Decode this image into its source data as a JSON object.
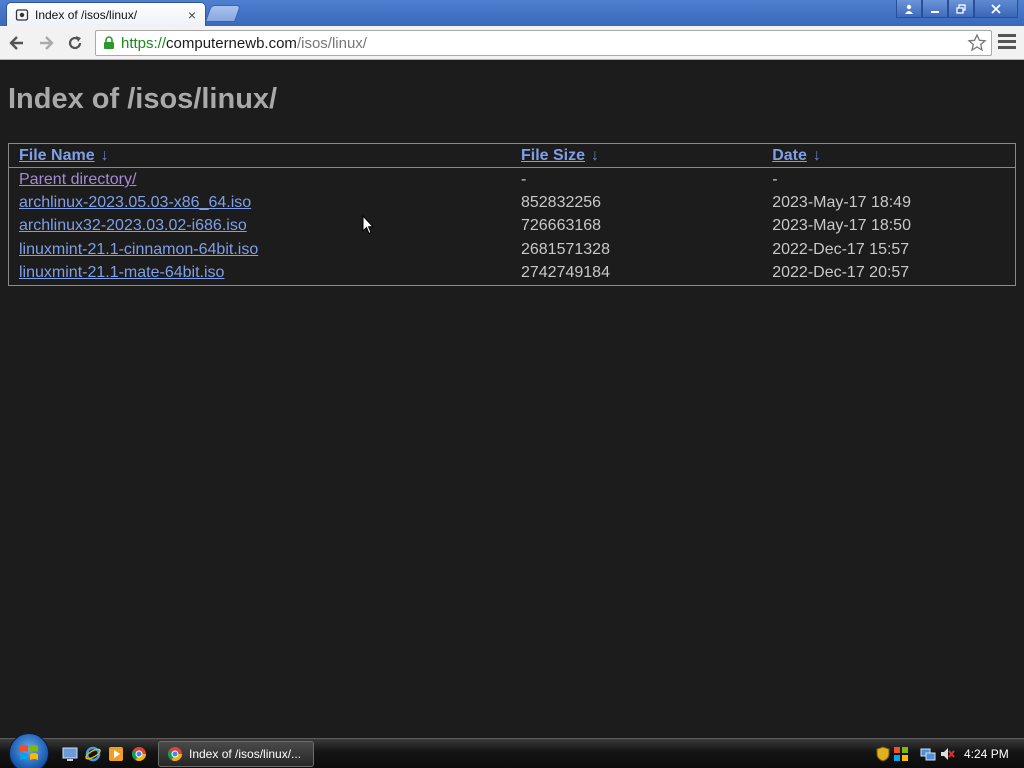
{
  "browser": {
    "tab_title": "Index of /isos/linux/",
    "url_scheme": "https://",
    "url_host": "computernewb.com",
    "url_path": "/isos/linux/"
  },
  "page": {
    "title": "Index of /isos/linux/",
    "columns": [
      {
        "label": "File Name",
        "arrow": "↓"
      },
      {
        "label": "File Size",
        "arrow": "↓"
      },
      {
        "label": "Date",
        "arrow": "↓"
      }
    ],
    "rows": [
      {
        "name": "Parent directory/",
        "size": "-",
        "date": "-"
      },
      {
        "name": "archlinux-2023.05.03-x86_64.iso",
        "size": "852832256",
        "date": "2023-May-17 18:49"
      },
      {
        "name": "archlinux32-2023.03.02-i686.iso",
        "size": "726663168",
        "date": "2023-May-17 18:50"
      },
      {
        "name": "linuxmint-21.1-cinnamon-64bit.iso",
        "size": "2681571328",
        "date": "2022-Dec-17 15:57"
      },
      {
        "name": "linuxmint-21.1-mate-64bit.iso",
        "size": "2742749184",
        "date": "2022-Dec-17 20:57"
      }
    ]
  },
  "taskbar": {
    "window_label": "Index of /isos/linux/...",
    "clock": "4:24 PM"
  },
  "colors": {
    "page_bg": "#1c1c1c",
    "link": "#7f9fe8",
    "visited_link": "#a78ad6",
    "heading": "#a9a9a9"
  }
}
